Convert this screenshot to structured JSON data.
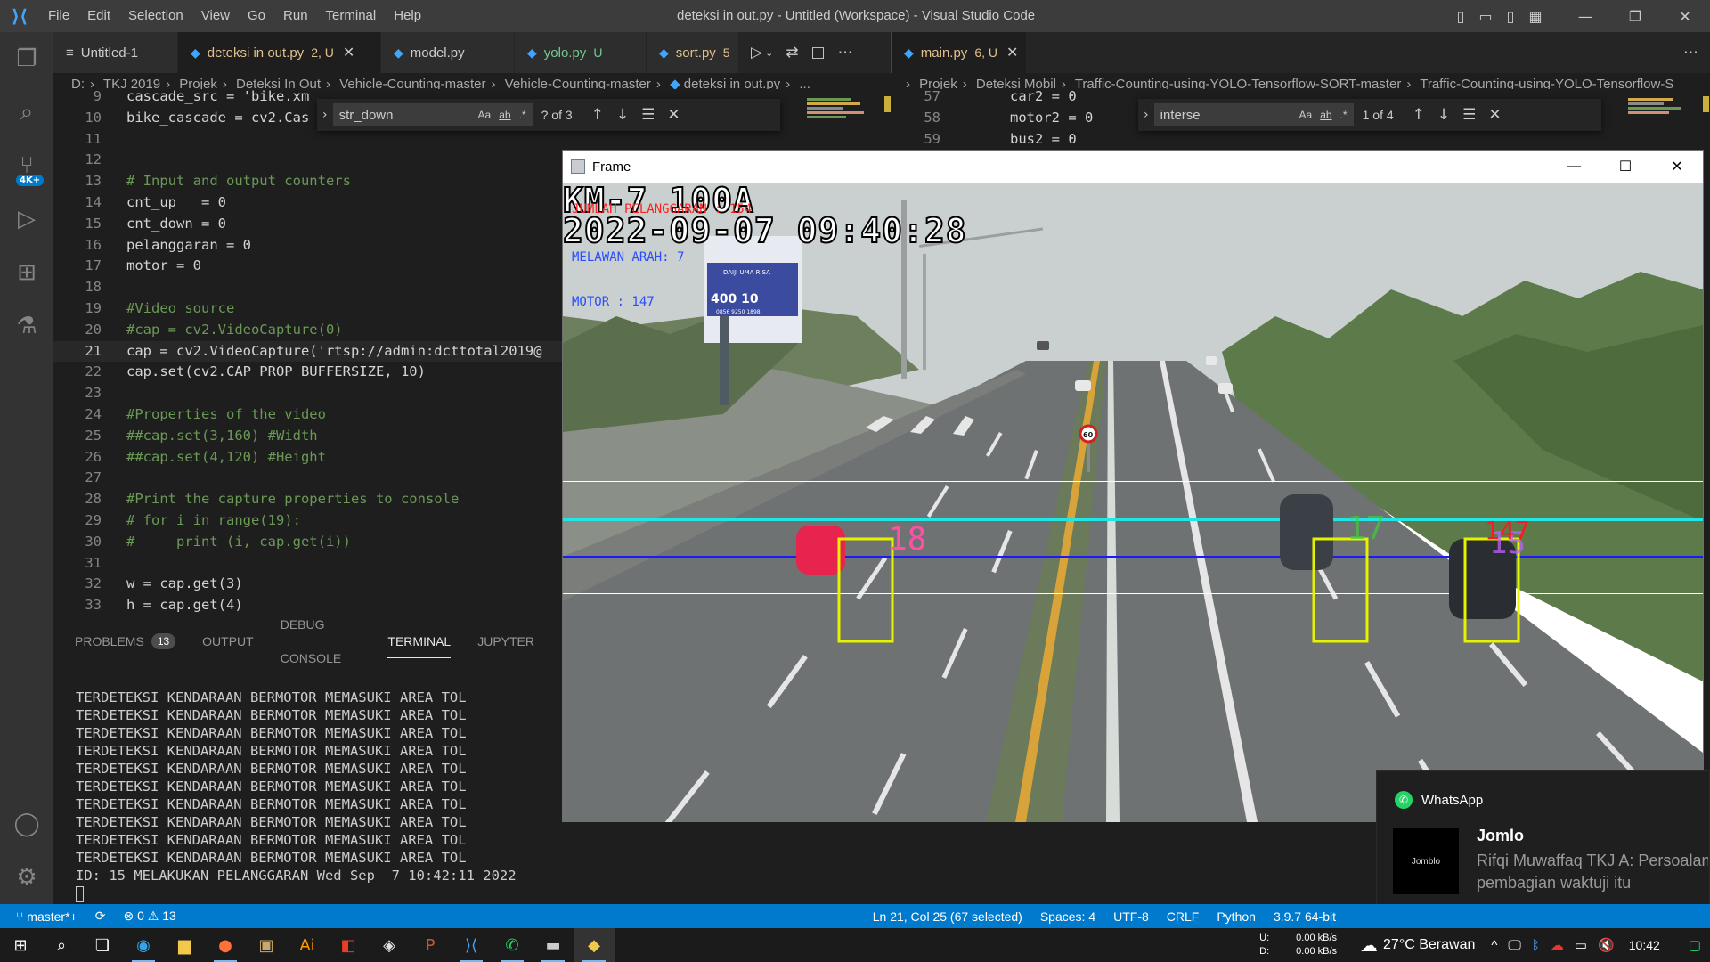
{
  "titlebar": {
    "menu": [
      "File",
      "Edit",
      "Selection",
      "View",
      "Go",
      "Run",
      "Terminal",
      "Help"
    ],
    "title": "deteksi in out.py - Untitled (Workspace) - Visual Studio Code"
  },
  "activity": {
    "scm_badge": "4K+"
  },
  "left_editor": {
    "tabs": [
      {
        "label": "Untitled-1",
        "status": ""
      },
      {
        "label": "deteksi in out.py",
        "status": "2, U"
      },
      {
        "label": "model.py",
        "status": ""
      },
      {
        "label": "yolo.py",
        "status": "U"
      },
      {
        "label": "sort.py",
        "status": "5"
      }
    ],
    "breadcrumb": [
      "D:",
      "TKJ 2019",
      "Projek",
      "Deteksi In Out",
      "Vehicle-Counting-master",
      "Vehicle-Counting-master",
      "deteksi in out.py",
      "..."
    ],
    "find": {
      "value": "str_down",
      "count": "? of 3",
      "opt_case": "Aa",
      "opt_word": "ab",
      "opt_regex": ".*"
    },
    "lines": [
      {
        "n": "9",
        "code": "cascade_src = 'bike.xm"
      },
      {
        "n": "10",
        "code": "bike_cascade = cv2.Cas"
      },
      {
        "n": "11",
        "code": ""
      },
      {
        "n": "12",
        "code": ""
      },
      {
        "n": "13",
        "code": "# Input and output counters"
      },
      {
        "n": "14",
        "code": "cnt_up   = 0"
      },
      {
        "n": "15",
        "code": "cnt_down = 0"
      },
      {
        "n": "16",
        "code": "pelanggaran = 0"
      },
      {
        "n": "17",
        "code": "motor = 0"
      },
      {
        "n": "18",
        "code": ""
      },
      {
        "n": "19",
        "code": "#Video source"
      },
      {
        "n": "20",
        "code": "#cap = cv2.VideoCapture(0)"
      },
      {
        "n": "21",
        "code": "cap = cv2.VideoCapture('rtsp://admin:dcttotal2019@"
      },
      {
        "n": "22",
        "code": "cap.set(cv2.CAP_PROP_BUFFERSIZE, 10)"
      },
      {
        "n": "23",
        "code": ""
      },
      {
        "n": "24",
        "code": "#Properties of the video"
      },
      {
        "n": "25",
        "code": "##cap.set(3,160) #Width"
      },
      {
        "n": "26",
        "code": "##cap.set(4,120) #Height"
      },
      {
        "n": "27",
        "code": ""
      },
      {
        "n": "28",
        "code": "#Print the capture properties to console"
      },
      {
        "n": "29",
        "code": "# for i in range(19):"
      },
      {
        "n": "30",
        "code": "#     print (i, cap.get(i))"
      },
      {
        "n": "31",
        "code": ""
      },
      {
        "n": "32",
        "code": "w = cap.get(3)"
      },
      {
        "n": "33",
        "code": "h = cap.get(4)"
      }
    ]
  },
  "right_editor": {
    "tabs": [
      {
        "label": "main.py",
        "status": "6, U"
      }
    ],
    "breadcrumb": [
      "Projek",
      "Deteksi Mobil",
      "Traffic-Counting-using-YOLO-Tensorflow-SORT-master",
      "Traffic-Counting-using-YOLO-Tensorflow-S"
    ],
    "find": {
      "value": "interse",
      "count": "1 of 4",
      "opt_case": "Aa",
      "opt_word": "ab",
      "opt_regex": ".*"
    },
    "lines": [
      {
        "n": "57",
        "code": "car2 = 0"
      },
      {
        "n": "58",
        "code": "motor2 = 0"
      },
      {
        "n": "59",
        "code": "bus2 = 0"
      }
    ]
  },
  "panel": {
    "tabs": [
      "PROBLEMS",
      "OUTPUT",
      "DEBUG CONSOLE",
      "TERMINAL",
      "JUPYTER"
    ],
    "problems_count": "13",
    "terminal_lines": [
      "TERDETEKSI KENDARAAN BERMOTOR MEMASUKI AREA TOL",
      "TERDETEKSI KENDARAAN BERMOTOR MEMASUKI AREA TOL",
      "TERDETEKSI KENDARAAN BERMOTOR MEMASUKI AREA TOL",
      "TERDETEKSI KENDARAAN BERMOTOR MEMASUKI AREA TOL",
      "TERDETEKSI KENDARAAN BERMOTOR MEMASUKI AREA TOL",
      "TERDETEKSI KENDARAAN BERMOTOR MEMASUKI AREA TOL",
      "TERDETEKSI KENDARAAN BERMOTOR MEMASUKI AREA TOL",
      "TERDETEKSI KENDARAAN BERMOTOR MEMASUKI AREA TOL",
      "TERDETEKSI KENDARAAN BERMOTOR MEMASUKI AREA TOL",
      "TERDETEKSI KENDARAAN BERMOTOR MEMASUKI AREA TOL",
      "ID: 15 MELAKUKAN PELANGGARAN Wed Sep  7 10:42:11 2022"
    ]
  },
  "frame": {
    "title": "Frame",
    "overlay": {
      "km": "KM-7 100A",
      "jumlah": "JUMLAH PELANGGARAN : 154",
      "datetime": "2022-09-07 09:40:28",
      "melawan": "MELAWAN ARAH: 7",
      "motor": "MOTOR : 147",
      "sign_speed": "60",
      "billboard_1": "DAIJI UMA RISA",
      "billboard_2": "400 10",
      "billboard_3": "0856 9250 1898",
      "ids": [
        {
          "text": "18",
          "color": "#ff4fa6"
        },
        {
          "text": "17",
          "color": "#3bd13b"
        },
        {
          "text": "147",
          "color": "#ff1a1a"
        },
        {
          "text": "15",
          "color": "#c060ff"
        }
      ]
    }
  },
  "toast": {
    "app": "WhatsApp",
    "avatar_text": "Jomblo",
    "sender": "Jomlo",
    "message_1": "Rifqi Muwaffaq TKJ A: Persoalan",
    "message_2": "pembagian waktuji itu"
  },
  "statusbar": {
    "branch": "master*+",
    "errors": "0",
    "warnings": "13",
    "position": "Ln 21, Col 25 (67 selected)",
    "spaces": "Spaces: 4",
    "encoding": "UTF-8",
    "eol": "CRLF",
    "language": "Python",
    "interpreter": "3.9.7 64-bit"
  },
  "taskbar": {
    "net_up_label": "U:",
    "net_down_label": "D:",
    "net_up": "0.00 kB/s",
    "net_down": "0.00 kB/s",
    "weather": "27°C  Berawan",
    "time": "10:42"
  },
  "colors": {
    "accent": "#007acc",
    "box_yellow": "#e5f200",
    "line_cyan": "#22e6e6",
    "line_blue": "#1a1aff",
    "overlay_red": "#ff2020",
    "overlay_blue": "#2a4dff"
  }
}
